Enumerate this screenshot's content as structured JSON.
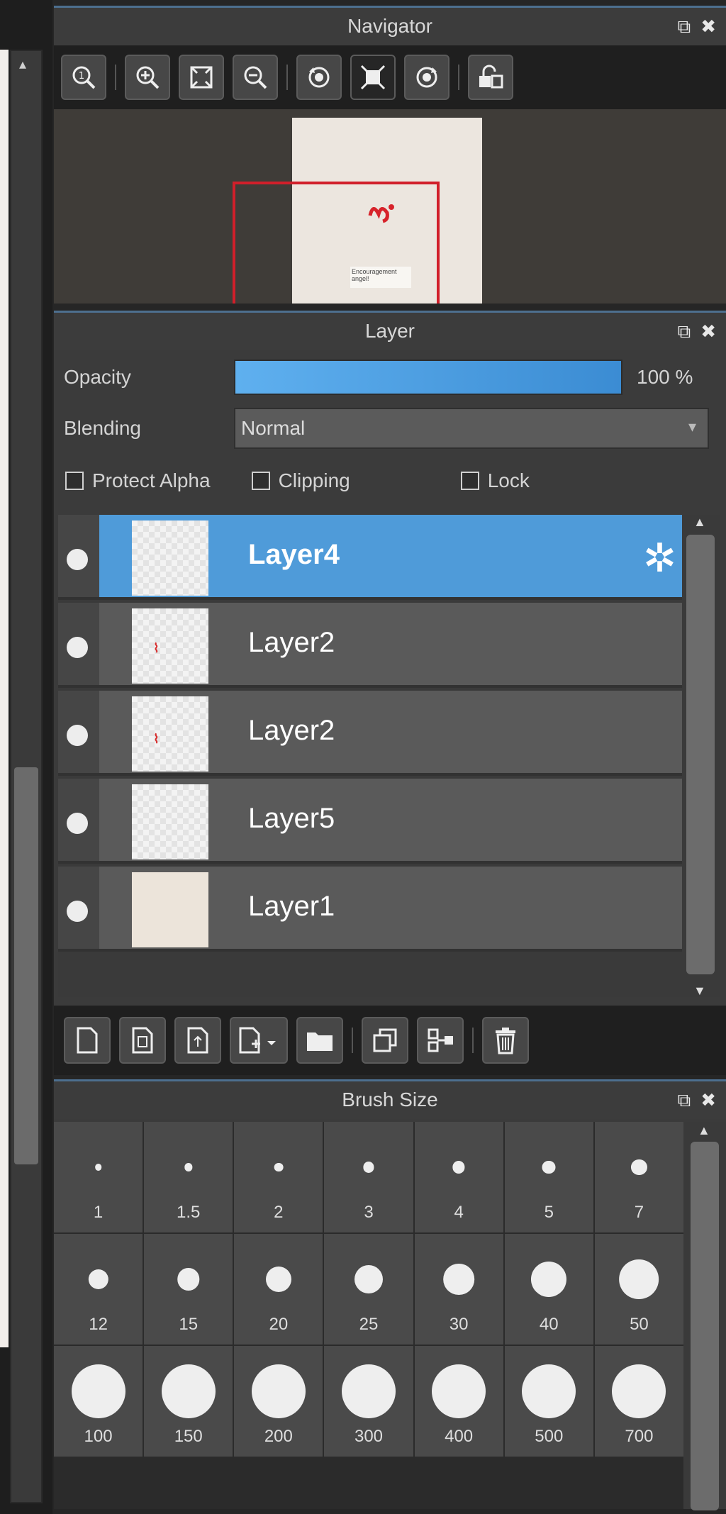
{
  "navigator": {
    "title": "Navigator",
    "toolbar": [
      "zoom-fit-icon",
      "zoom-in-icon",
      "fit-window-icon",
      "zoom-out-icon",
      "rotate-left-icon",
      "actual-size-icon",
      "rotate-right-icon",
      "flip-lock-icon"
    ],
    "preview_note": "Encouragement angel!"
  },
  "layer": {
    "title": "Layer",
    "opacity_label": "Opacity",
    "opacity_value": "100 %",
    "opacity_level": 1.0,
    "blending_label": "Blending",
    "blending_value": "Normal",
    "protect_alpha_label": "Protect Alpha",
    "clipping_label": "Clipping",
    "lock_label": "Lock",
    "layers": [
      {
        "name": "Layer4",
        "selected": true
      },
      {
        "name": "Layer2",
        "selected": false
      },
      {
        "name": "Layer2",
        "selected": false
      },
      {
        "name": "Layer5",
        "selected": false
      },
      {
        "name": "Layer1",
        "selected": false
      }
    ],
    "toolbar": [
      "new-layer-icon",
      "copy-layer-icon",
      "import-layer-icon",
      "add-layer-menu-icon",
      "folder-icon",
      "duplicate-icon",
      "merge-icon",
      "delete-icon"
    ]
  },
  "brush_size": {
    "title": "Brush Size",
    "sizes": [
      "1",
      "1.5",
      "2",
      "3",
      "4",
      "5",
      "7",
      "12",
      "15",
      "20",
      "25",
      "30",
      "40",
      "50",
      "100",
      "150",
      "200",
      "300",
      "400",
      "500",
      "700"
    ]
  },
  "colors": {
    "accent": "#4f9bd9",
    "selection_rect": "#d11f2a"
  }
}
